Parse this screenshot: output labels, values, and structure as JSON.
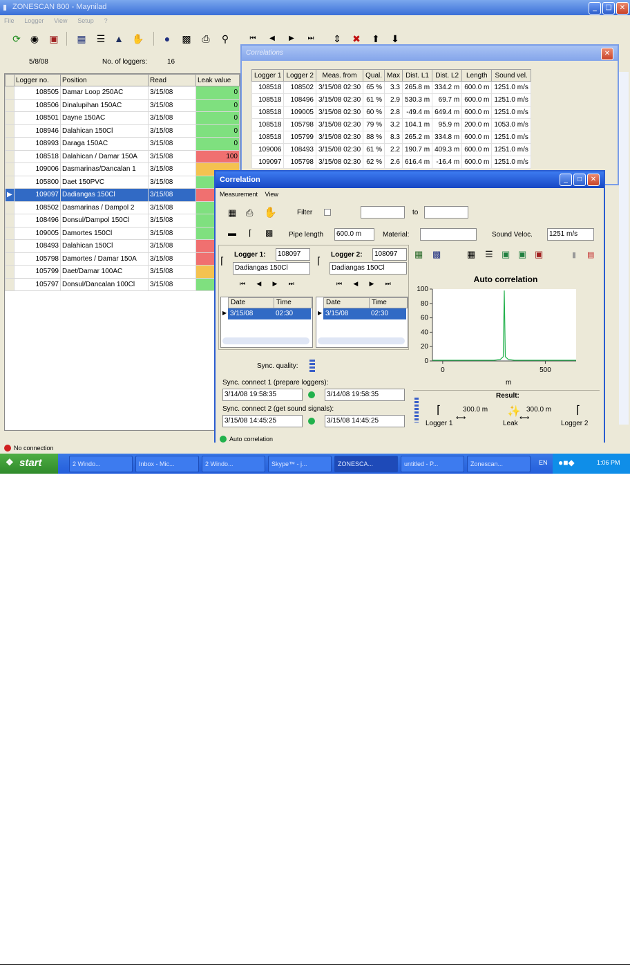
{
  "app": {
    "title": "ZONESCAN 800 - Maynilad"
  },
  "menu": [
    "File",
    "Logger",
    "View",
    "Setup",
    "?"
  ],
  "toolbar": {
    "icons": [
      "refresh-icon",
      "eye-icon",
      "logger-icon",
      "database-icon",
      "list-icon",
      "ship-icon",
      "hand-icon",
      "globe-icon",
      "report-icon",
      "print-icon",
      "magnifier-icon",
      "first-icon",
      "prev-icon",
      "next-icon",
      "last-icon",
      "logger-down-icon",
      "logger-delete-icon",
      "arrow-up-icon",
      "arrow-down-icon"
    ]
  },
  "info": {
    "date": "5/8/08",
    "no_loggers_label": "No. of loggers:",
    "no_loggers": "16"
  },
  "loggers": {
    "columns": [
      "Logger no.",
      "Position",
      "Read",
      "Leak value"
    ],
    "rows": [
      {
        "no": "108505",
        "pos": "Damar Loop 250AC",
        "read": "3/15/08",
        "leak": "0",
        "color": "#7fe07f"
      },
      {
        "no": "108506",
        "pos": "Dinalupihan 150AC",
        "read": "3/15/08",
        "leak": "0",
        "color": "#7fe07f"
      },
      {
        "no": "108501",
        "pos": "Dayne 150AC",
        "read": "3/15/08",
        "leak": "0",
        "color": "#7fe07f"
      },
      {
        "no": "108946",
        "pos": "Dalahican 150Cl",
        "read": "3/15/08",
        "leak": "0",
        "color": "#7fe07f"
      },
      {
        "no": "108993",
        "pos": "Daraga 150AC",
        "read": "3/15/08",
        "leak": "0",
        "color": "#7fe07f"
      },
      {
        "no": "108518",
        "pos": "Dalahican / Damar 150A",
        "read": "3/15/08",
        "leak": "100",
        "color": "#f07070"
      },
      {
        "no": "109006",
        "pos": "Dasmarinas/Dancalan 1",
        "read": "3/15/08",
        "leak": "",
        "color": "#f4c250"
      },
      {
        "no": "105800",
        "pos": "Daet 150PVC",
        "read": "3/15/08",
        "leak": "",
        "color": "#7fe07f"
      },
      {
        "no": "109097",
        "pos": "Dadiangas 150Cl",
        "read": "3/15/08",
        "leak": "",
        "color": "#f07070",
        "selected": true
      },
      {
        "no": "108502",
        "pos": "Dasmarinas / Dampol 2",
        "read": "3/15/08",
        "leak": "",
        "color": "#7fe07f"
      },
      {
        "no": "108496",
        "pos": "Donsul/Dampol 150Cl",
        "read": "3/15/08",
        "leak": "",
        "color": "#7fe07f"
      },
      {
        "no": "109005",
        "pos": "Damortes 150Cl",
        "read": "3/15/08",
        "leak": "",
        "color": "#7fe07f"
      },
      {
        "no": "108493",
        "pos": "Dalahican 150Cl",
        "read": "3/15/08",
        "leak": "",
        "color": "#f07070"
      },
      {
        "no": "105798",
        "pos": "Damortes / Damar 150A",
        "read": "3/15/08",
        "leak": "",
        "color": "#f07070"
      },
      {
        "no": "105799",
        "pos": "Daet/Damar 100AC",
        "read": "3/15/08",
        "leak": "",
        "color": "#f4c250"
      },
      {
        "no": "105797",
        "pos": "Donsul/Dancalan 100Cl",
        "read": "3/15/08",
        "leak": "",
        "color": "#7fe07f"
      }
    ]
  },
  "correlations": {
    "title": "Correlations",
    "columns": [
      "Logger 1",
      "Logger 2",
      "Meas. from",
      "Qual.",
      "Max",
      "Dist. L1",
      "Dist. L2",
      "Length",
      "Sound vel."
    ],
    "rows": [
      [
        "108518",
        "108502",
        "3/15/08 02:30",
        "65 %",
        "3.3",
        "265.8 m",
        "334.2 m",
        "600.0 m",
        "1251.0 m/s"
      ],
      [
        "108518",
        "108496",
        "3/15/08 02:30",
        "61 %",
        "2.9",
        "530.3 m",
        "69.7 m",
        "600.0 m",
        "1251.0 m/s"
      ],
      [
        "108518",
        "109005",
        "3/15/08 02:30",
        "60 %",
        "2.8",
        "-49.4 m",
        "649.4 m",
        "600.0 m",
        "1251.0 m/s"
      ],
      [
        "108518",
        "105798",
        "3/15/08 02:30",
        "79 %",
        "3.2",
        "104.1 m",
        "95.9 m",
        "200.0 m",
        "1053.0 m/s"
      ],
      [
        "108518",
        "105799",
        "3/15/08 02:30",
        "88 %",
        "8.3",
        "265.2 m",
        "334.8 m",
        "600.0 m",
        "1251.0 m/s"
      ],
      [
        "109006",
        "108493",
        "3/15/08 02:30",
        "61 %",
        "2.2",
        "190.7 m",
        "409.3 m",
        "600.0 m",
        "1251.0 m/s"
      ],
      [
        "109097",
        "105798",
        "3/15/08 02:30",
        "62 %",
        "2.6",
        "616.4 m",
        "-16.4 m",
        "600.0 m",
        "1251.0 m/s"
      ]
    ]
  },
  "dialog": {
    "title": "Correlation",
    "menu": [
      "Measurement",
      "View"
    ],
    "filter_label": "Filter",
    "to_label": "to",
    "pipe_length_label": "Pipe length",
    "pipe_length": "600.0 m",
    "material_label": "Material:",
    "material": "",
    "sound_veloc_label": "Sound Veloc.",
    "sound_veloc": "1251 m/s",
    "logger1": {
      "label": "Logger 1:",
      "no": "108097",
      "position": "Dadiangas 150Cl",
      "date": "3/15/08",
      "time": "02:30"
    },
    "logger2": {
      "label": "Logger 2:",
      "no": "108097",
      "position": "Dadiangas 150Cl",
      "date": "3/15/08",
      "time": "02:30"
    },
    "date_col": "Date",
    "time_col": "Time",
    "sync_quality_label": "Sync. quality:",
    "sync1_label": "Sync. connect 1 (prepare loggers):",
    "sync1_a": "3/14/08 19:58:35",
    "sync1_b": "3/14/08 19:58:35",
    "sync2_label": "Sync. connect 2 (get sound signals):",
    "sync2_a": "3/15/08 14:45:25",
    "sync2_b": "3/15/08 14:45:25",
    "result_label": "Result:",
    "dist1": "300.0 m",
    "dist2": "300.0 m",
    "res_logger1": "Logger 1",
    "res_leak": "Leak",
    "res_logger2": "Logger 2",
    "status": "Auto correlation"
  },
  "chart_data": {
    "type": "line",
    "title": "Auto correlation",
    "xlabel": "m",
    "ylabel": "",
    "xlim": [
      -50,
      650
    ],
    "ylim": [
      0,
      100
    ],
    "xticks": [
      "0",
      "500"
    ],
    "yticks": [
      "0",
      "20",
      "40",
      "60",
      "80",
      "100"
    ],
    "series": [
      {
        "x": [
          -50,
          250,
          280,
          295,
          300,
          305,
          320,
          350,
          650
        ],
        "y": [
          1,
          1,
          2,
          6,
          98,
          6,
          2,
          1,
          1
        ]
      }
    ],
    "color": "#22b14c"
  },
  "status": {
    "text": "No connection"
  },
  "taskbar": {
    "start": "start",
    "tasks": [
      "2 Windo...",
      "Inbox - Mic...",
      "2 Windo...",
      "Skype™ - j...",
      "ZONESCA...",
      "untitled - P...",
      "Zonescan..."
    ],
    "lang": "EN",
    "clock": "1:06 PM"
  }
}
